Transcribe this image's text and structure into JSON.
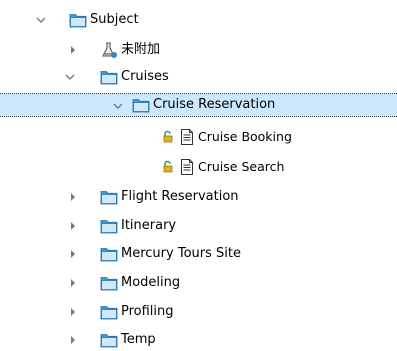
{
  "tree": {
    "subject": "Subject",
    "unattached": "未附加",
    "cruises": "Cruises",
    "cruise_reservation": "Cruise Reservation",
    "cruise_booking": "Cruise Booking",
    "cruise_search": "Cruise Search",
    "flight_reservation": "Flight Reservation",
    "itinerary": "Itinerary",
    "mercury_tours_site": "Mercury Tours Site",
    "modeling": "Modeling",
    "profiling": "Profiling",
    "temp": "Temp"
  },
  "icons": {
    "expanded": "chevron-down-icon",
    "collapsed": "chevron-right-icon",
    "folder": "folder-icon",
    "flask": "flask-icon",
    "test": "test-document-icon",
    "lock": "lock-icon"
  },
  "colors": {
    "selection_bg": "#cce8ff",
    "folder_blue": "#3f9bd9",
    "arrow_gray": "#7a7a7a",
    "lock_green": "#2e8b2e"
  }
}
